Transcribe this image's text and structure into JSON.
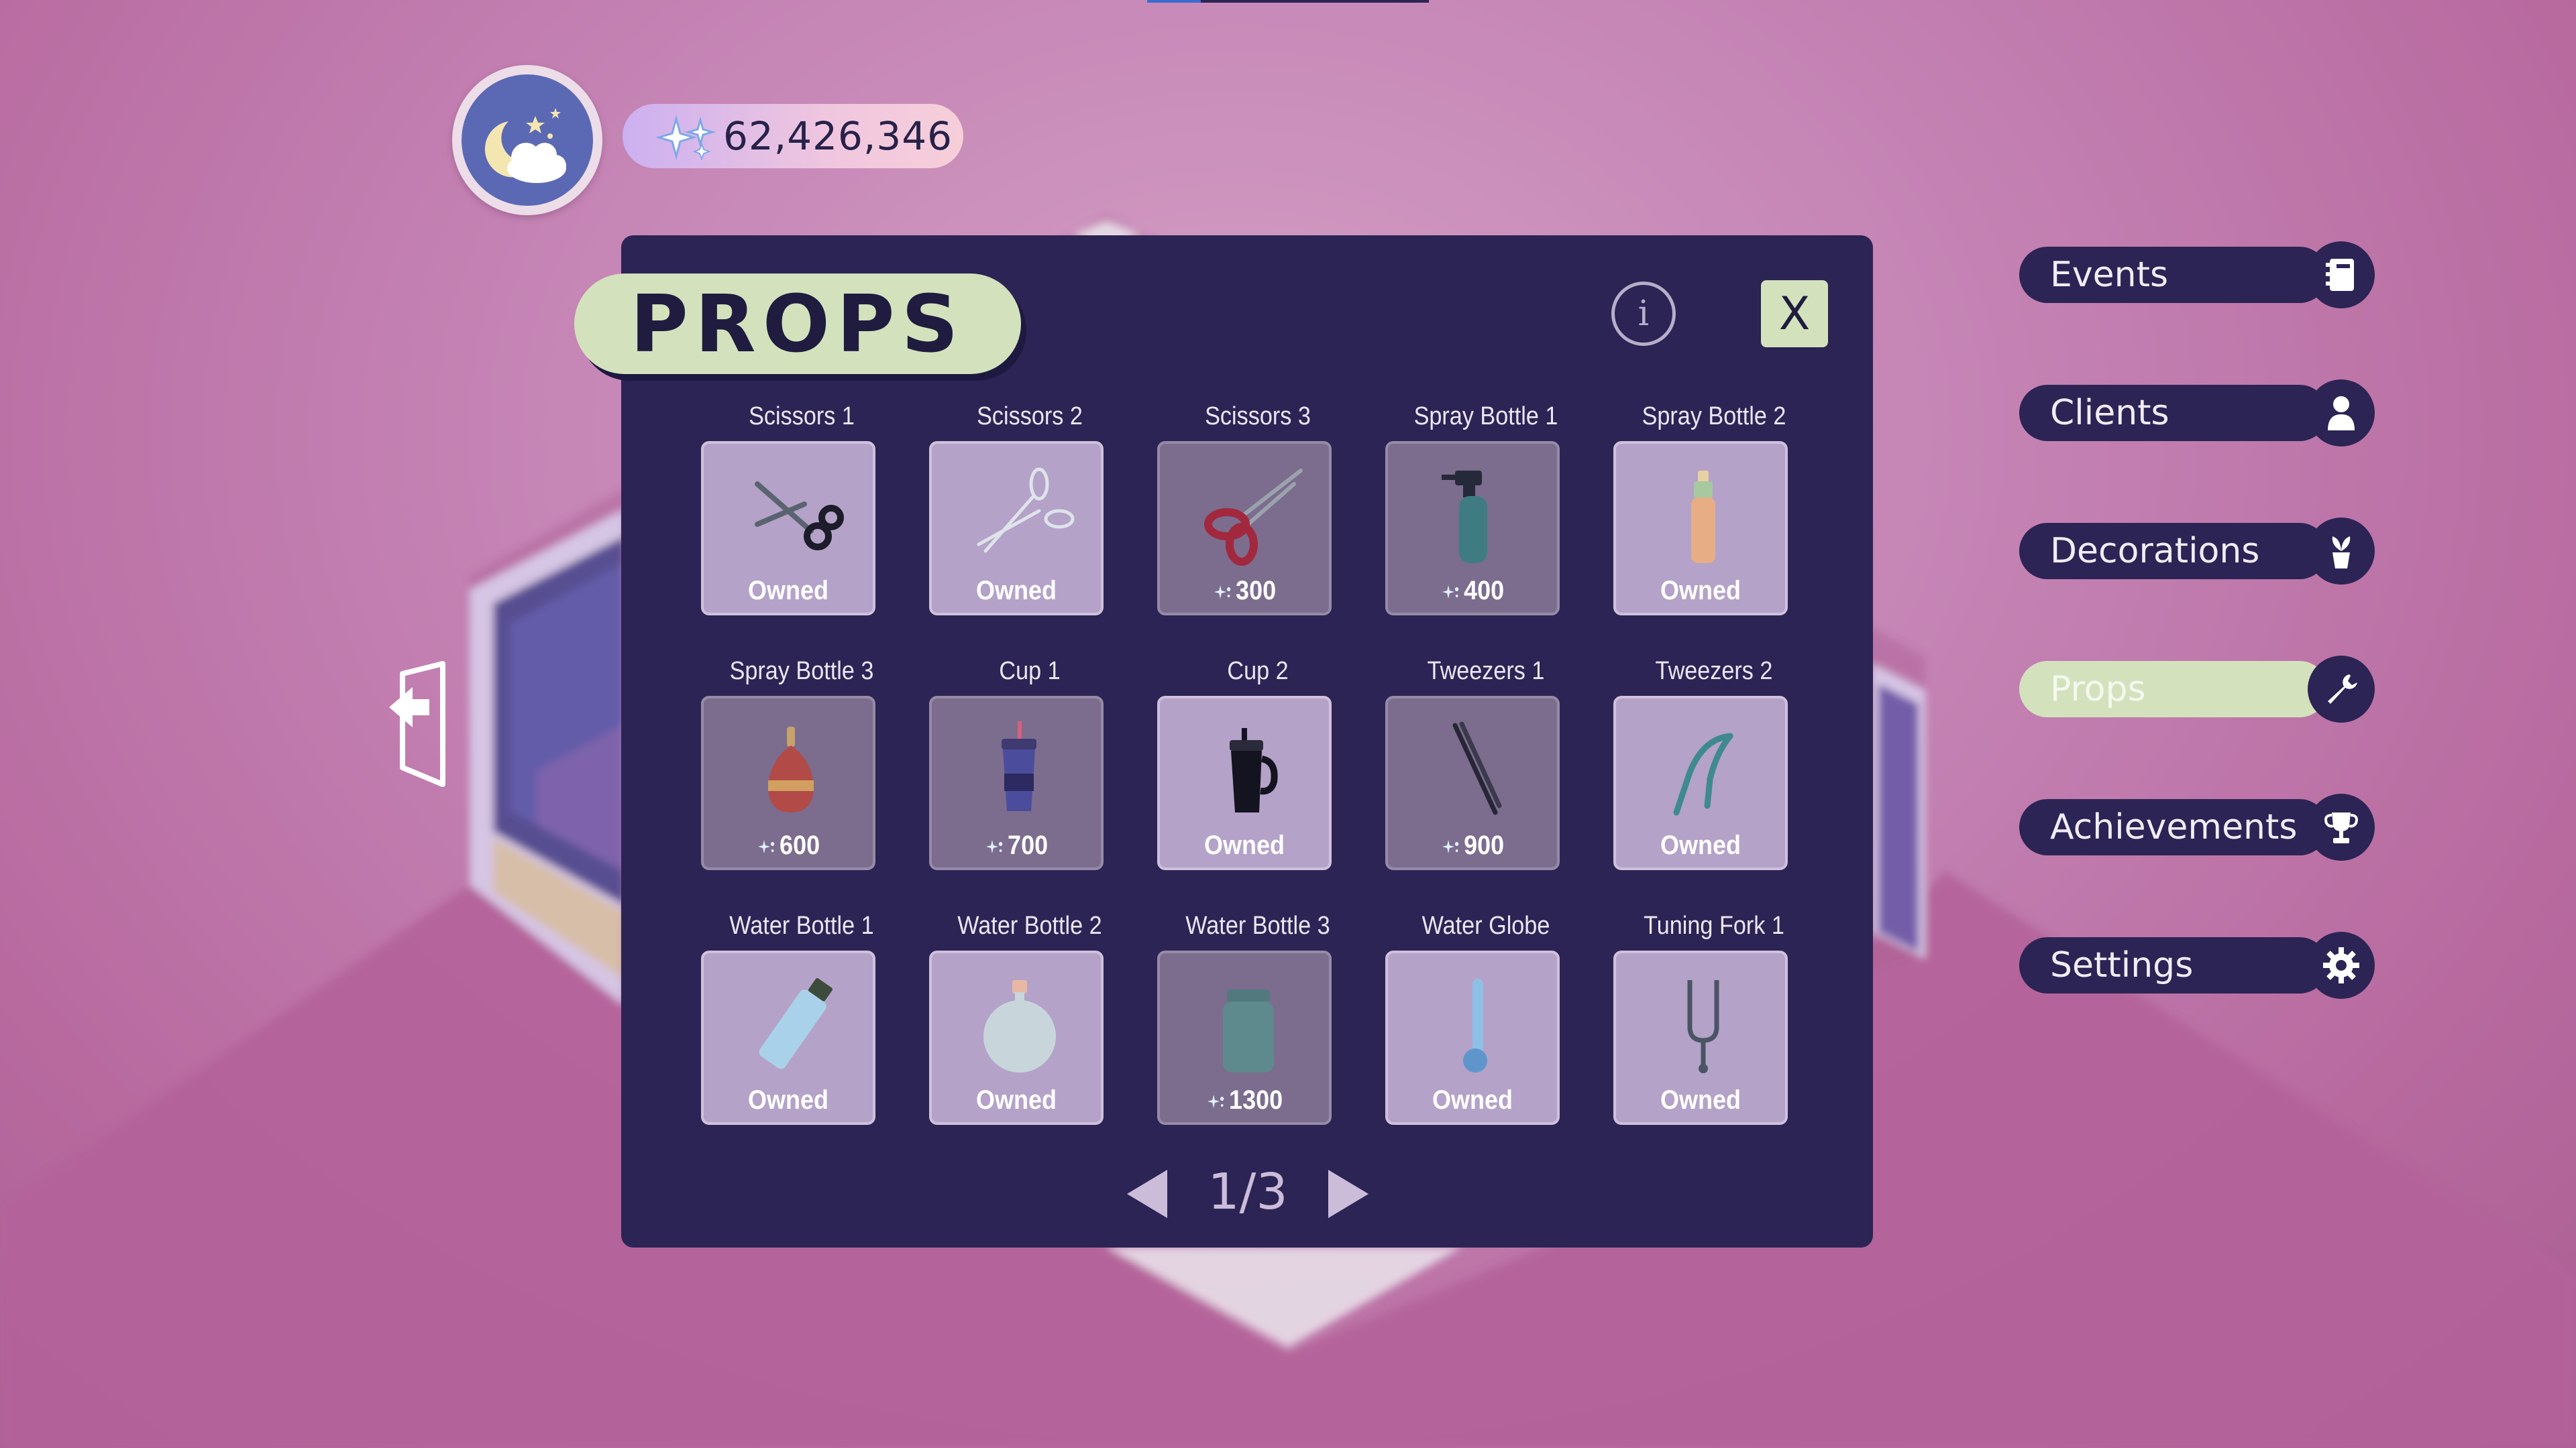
{
  "hud": {
    "currency_value": "62,426,346",
    "avatar_icon": "moon-cloud-icon",
    "currency_icon": "sparkles-icon"
  },
  "panel": {
    "title": "PROPS",
    "info_label": "i",
    "close_label": "X",
    "items": [
      {
        "name": "Scissors 1",
        "status": "Owned",
        "owned": true,
        "icon": "scissors-black-icon"
      },
      {
        "name": "Scissors 2",
        "status": "Owned",
        "owned": true,
        "icon": "scissors-silver-icon"
      },
      {
        "name": "Scissors 3",
        "status": "300",
        "owned": false,
        "icon": "scissors-red-icon"
      },
      {
        "name": "Spray Bottle 1",
        "status": "400",
        "owned": false,
        "icon": "spray-bottle-teal-icon"
      },
      {
        "name": "Spray Bottle 2",
        "status": "Owned",
        "owned": true,
        "icon": "spray-bottle-peach-icon"
      },
      {
        "name": "Spray Bottle 3",
        "status": "600",
        "owned": false,
        "icon": "spray-bottle-red-icon"
      },
      {
        "name": "Cup 1",
        "status": "700",
        "owned": false,
        "icon": "cup-purple-icon"
      },
      {
        "name": "Cup 2",
        "status": "Owned",
        "owned": true,
        "icon": "tumbler-black-icon"
      },
      {
        "name": "Tweezers 1",
        "status": "900",
        "owned": false,
        "icon": "tweezers-dark-icon"
      },
      {
        "name": "Tweezers 2",
        "status": "Owned",
        "owned": true,
        "icon": "tweezers-teal-icon"
      },
      {
        "name": "Water Bottle 1",
        "status": "Owned",
        "owned": true,
        "icon": "water-bottle-blue-icon"
      },
      {
        "name": "Water Bottle 2",
        "status": "Owned",
        "owned": true,
        "icon": "water-flask-round-icon"
      },
      {
        "name": "Water Bottle 3",
        "status": "1300",
        "owned": false,
        "icon": "water-jar-teal-icon"
      },
      {
        "name": "Water Globe",
        "status": "Owned",
        "owned": true,
        "icon": "water-globe-icon"
      },
      {
        "name": "Tuning Fork 1",
        "status": "Owned",
        "owned": true,
        "icon": "tuning-fork-icon"
      }
    ],
    "pagination": {
      "label": "1/3",
      "current": 1,
      "total": 3
    }
  },
  "menu": {
    "items": [
      {
        "label": "Events",
        "icon": "notebook-icon",
        "active": false
      },
      {
        "label": "Clients",
        "icon": "person-icon",
        "active": false
      },
      {
        "label": "Decorations",
        "icon": "plant-icon",
        "active": false
      },
      {
        "label": "Props",
        "icon": "wrench-icon",
        "active": true
      },
      {
        "label": "Achievements",
        "icon": "trophy-icon",
        "active": false
      },
      {
        "label": "Settings",
        "icon": "gear-icon",
        "active": false
      }
    ]
  },
  "colors": {
    "panel_bg": "#2c2454",
    "accent_green": "#d3e2bd",
    "tile_owned": "#b4a2c8",
    "tile_locked": "#7c6c8e",
    "background_pink": "#c483b4"
  }
}
